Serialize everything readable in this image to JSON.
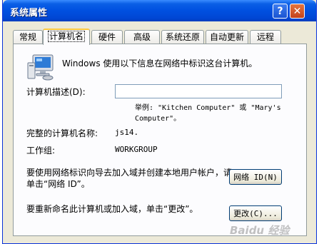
{
  "window": {
    "title": "系统属性",
    "help_glyph": "?",
    "close_glyph": "✕"
  },
  "tabs": [
    {
      "label": "常规",
      "active": false
    },
    {
      "label": "计算机名",
      "active": true
    },
    {
      "label": "硬件",
      "active": false
    },
    {
      "label": "高级",
      "active": false
    },
    {
      "label": "系统还原",
      "active": false
    },
    {
      "label": "自动更新",
      "active": false
    },
    {
      "label": "远程",
      "active": false
    }
  ],
  "panel": {
    "intro": "Windows 使用以下信息在网络中标识这台计算机。",
    "icon": "computer-icon",
    "description_label": "计算机描述(D):",
    "description_value": "",
    "example": "举例: \"Kitchen Computer\" 或 \"Mary's Computer\"。",
    "full_name_label": "完整的计算机名称:",
    "full_name_value": "js14.",
    "workgroup_label": "工作组:",
    "workgroup_value": "WORKGROUP",
    "network_id_text": "要使用网络标识向导去加入域并创建本地用户帐户，请单击“网络 ID”。",
    "network_id_button": "网络 ID(N)",
    "rename_text": "要重新命名此计算机或加入域，单击“更改”。",
    "change_button": "更改(C)..."
  },
  "watermark": "Baidu 经验",
  "colors": {
    "titlebar": "#0050e0",
    "dialog_bg": "#ece9d8",
    "panel_bg": "#fcfcfe",
    "active_tab_accent": "#ffc83c"
  }
}
